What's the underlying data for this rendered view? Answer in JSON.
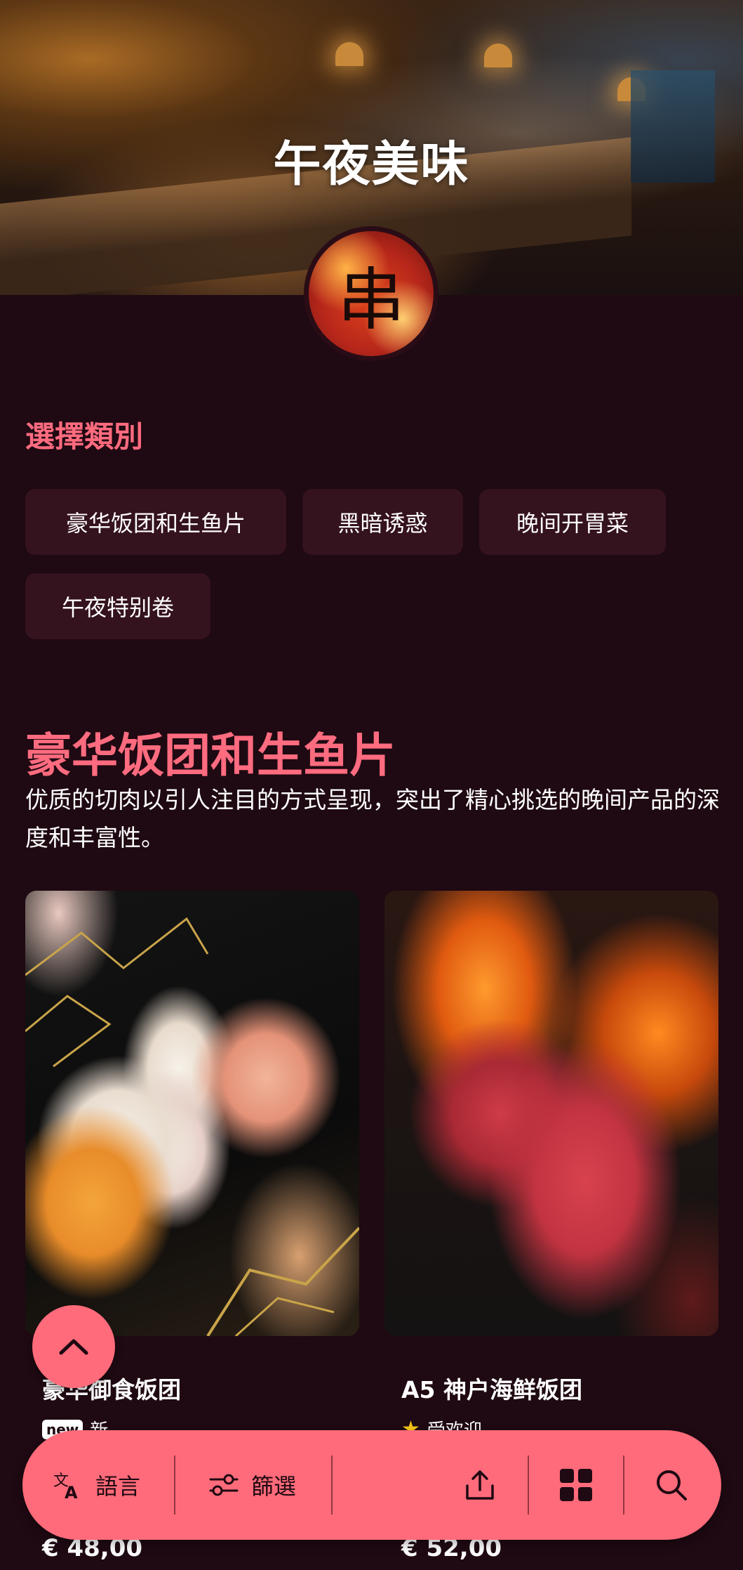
{
  "hero": {
    "title": "午夜美味",
    "logo_glyph": "串"
  },
  "categories": {
    "heading": "選擇類別",
    "chips": [
      "豪华饭团和生鱼片",
      "黑暗诱惑",
      "晚间开胃菜",
      "午夜特别卷"
    ]
  },
  "section": {
    "title": "豪华饭团和生鱼片",
    "description": "优质的切肉以引人注目的方式呈现，突出了精心挑选的晚间产品的深度和丰富性。"
  },
  "products": [
    {
      "name": "豪华御食饭团",
      "badge": "new",
      "tag": "新",
      "price": "€ 48,00",
      "image": "sushi-platter"
    },
    {
      "name": "A5 神户海鲜饭团",
      "badge_icon": "star-icon",
      "tag": "受欢迎",
      "price": "€ 52,00",
      "image": "seared-beef-flames"
    }
  ],
  "bottom_bar": {
    "language_label": "語言",
    "filter_label": "篩選"
  },
  "colors": {
    "background": "#1f0912",
    "accent": "#ff6b7a",
    "heading_accent": "#ff6b7f",
    "chip_bg": "#34121e"
  }
}
